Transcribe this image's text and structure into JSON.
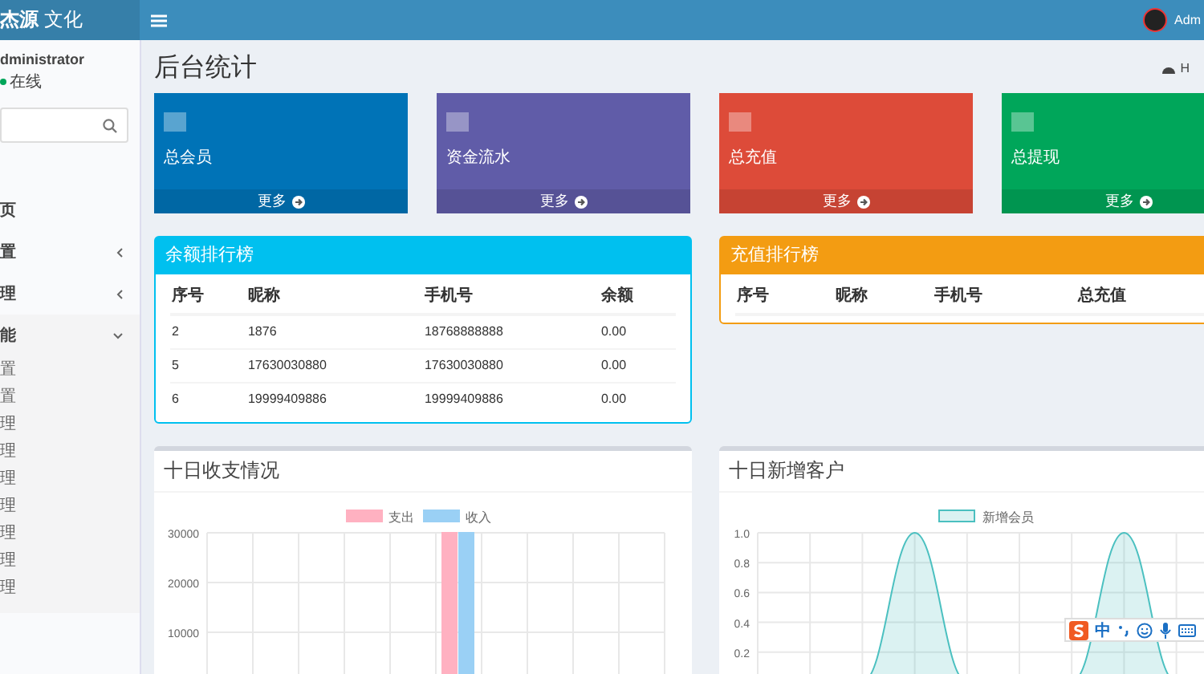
{
  "header": {
    "logo_strong": "杰源",
    "logo_light": "文化",
    "user": "Adm"
  },
  "sidebar": {
    "user_name": "dministrator",
    "status": "在线",
    "items": [
      {
        "kind": "link",
        "label": "页"
      },
      {
        "kind": "menu",
        "label": "置",
        "expanded": false
      },
      {
        "kind": "menu",
        "label": "理",
        "expanded": false
      },
      {
        "kind": "menu",
        "label": "能",
        "expanded": true,
        "children": [
          {
            "label": "置"
          },
          {
            "label": "置"
          },
          {
            "label": "理"
          },
          {
            "label": "理"
          },
          {
            "label": "理"
          },
          {
            "label": "理"
          },
          {
            "label": "理"
          },
          {
            "label": "理"
          },
          {
            "label": "理"
          }
        ]
      }
    ]
  },
  "page_title": "后台统计",
  "breadcrumb": "H",
  "stat_cards": [
    {
      "label": "总会员",
      "more": "更多",
      "color": "#0073b7"
    },
    {
      "label": "资金流水",
      "more": "更多",
      "color": "#605ca8"
    },
    {
      "label": "总充值",
      "more": "更多",
      "color": "#dd4b39"
    },
    {
      "label": "总提现",
      "more": "更多",
      "color": "#00a65a"
    }
  ],
  "rank_panels": [
    {
      "title": "余额排行榜",
      "color": "#00c0ef",
      "columns": [
        "序号",
        "昵称",
        "手机号",
        "余额"
      ],
      "rows": [
        [
          "2",
          "1876",
          "18768888888",
          "0.00"
        ],
        [
          "5",
          "17630030880",
          "17630030880",
          "0.00"
        ],
        [
          "6",
          "19999409886",
          "19999409886",
          "0.00"
        ]
      ]
    },
    {
      "title": "充值排行榜",
      "color": "#f39c12",
      "columns": [
        "序号",
        "昵称",
        "手机号",
        "总充值"
      ]
    }
  ],
  "charts": [
    {
      "title": "十日收支情况",
      "chart_data": {
        "type": "bar",
        "ylim": [
          0,
          30000
        ],
        "yticks": [
          10000,
          20000,
          30000
        ],
        "legend": true,
        "grid": true,
        "series": [
          {
            "name": "支出",
            "color": "#ffb1c1",
            "values": [
              0,
              0,
              0,
              0,
              0,
              30000,
              0,
              0,
              0,
              0
            ]
          },
          {
            "name": "收入",
            "color": "#9ad0f5",
            "values": [
              0,
              0,
              0,
              0,
              0,
              30000,
              0,
              0,
              0,
              0
            ]
          }
        ]
      }
    },
    {
      "title": "十日新增客户",
      "chart_data": {
        "type": "area",
        "ylim": [
          0,
          1
        ],
        "yticks": [
          0.2,
          0.4,
          0.6,
          0.8,
          {
            "value": 1,
            "label": "1.0"
          }
        ],
        "legend": true,
        "grid": true,
        "series": [
          {
            "name": "新增会员",
            "color": "#4bc0c0",
            "values": [
              0,
              0,
              0,
              1,
              0,
              0,
              0,
              1,
              0,
              0
            ]
          }
        ]
      }
    }
  ],
  "ime_toolbar": {
    "label": "中"
  }
}
